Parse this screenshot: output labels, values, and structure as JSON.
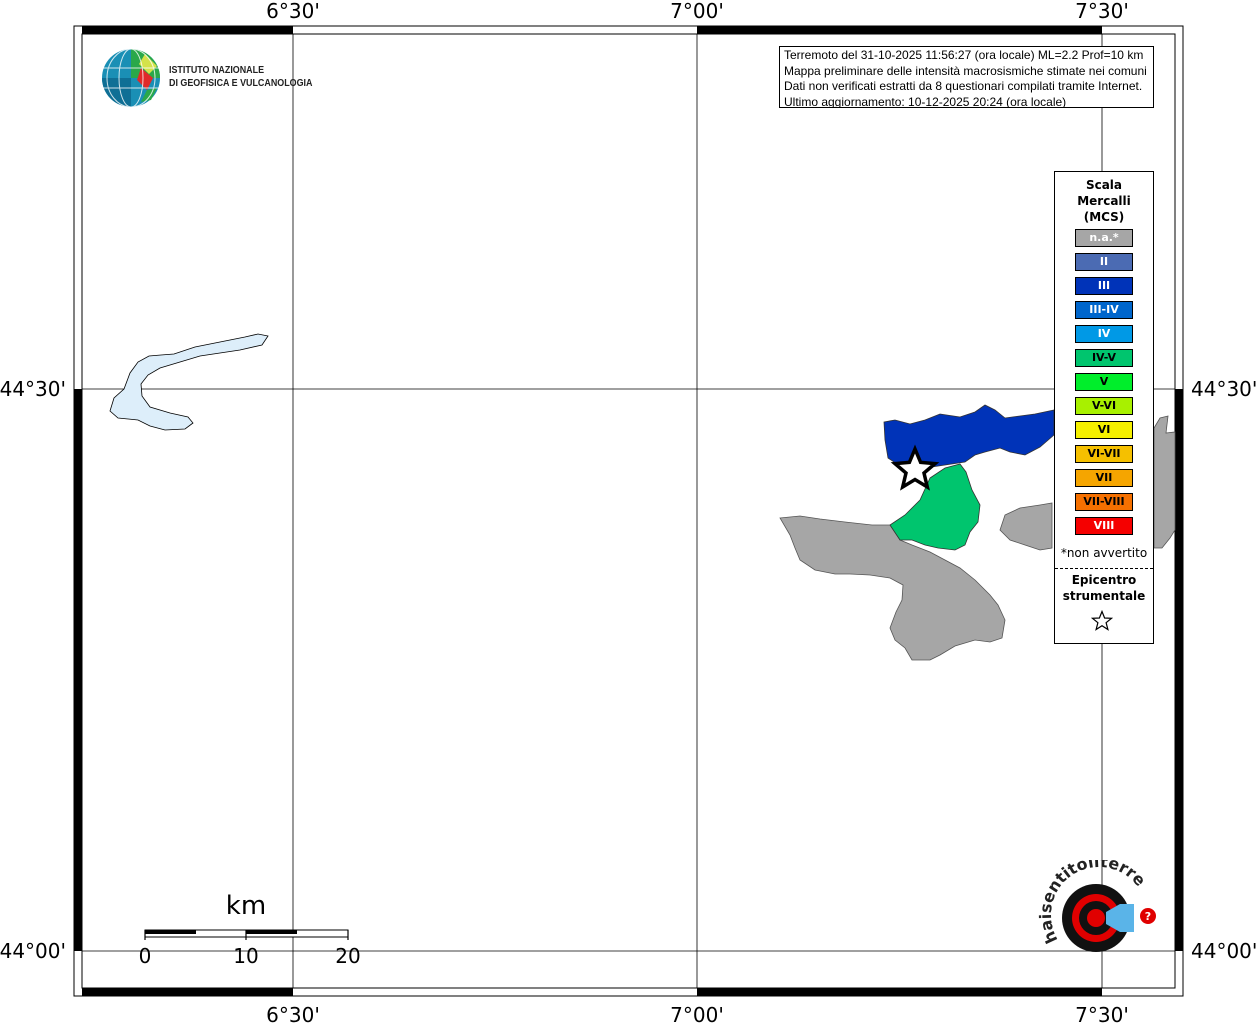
{
  "map": {
    "top_axis_labels": [
      "6°30'",
      "7°00'",
      "7°30'"
    ],
    "bottom_axis_labels": [
      "6°30'",
      "7°00'",
      "7°30'"
    ],
    "left_axis_labels": [
      "44°30'",
      "44°00'"
    ],
    "right_axis_labels": [
      "44°30'",
      "44°00'"
    ]
  },
  "info": {
    "line1": "Terremoto del 31-10-2025 11:56:27 (ora locale) ML=2.2 Prof=10 km",
    "line2": "Mappa preliminare delle intensità macrosismiche stimate nei comuni",
    "line3": "Dati non verificati estratti da 8 questionari compilati tramite Internet.",
    "line4": "Ultimo aggiornamento: 10-12-2025 20:24 (ora locale)"
  },
  "logo": {
    "line1": "ISTITUTO NAZIONALE",
    "line2": "DI GEOFISICA E VULCANOLOGIA"
  },
  "legend": {
    "title1": "Scala",
    "title2": "Mercalli",
    "title3": "(MCS)",
    "items": [
      {
        "label": "n.a.*",
        "color": "#a6a6a6"
      },
      {
        "label": "II",
        "color": "#4b6bb3"
      },
      {
        "label": "III",
        "color": "#0033b8"
      },
      {
        "label": "III-IV",
        "color": "#0066cc"
      },
      {
        "label": "IV",
        "color": "#0099e6"
      },
      {
        "label": "IV-V",
        "color": "#00c56e"
      },
      {
        "label": "V",
        "color": "#00ee2b"
      },
      {
        "label": "V-VI",
        "color": "#a8f000"
      },
      {
        "label": "VI",
        "color": "#f5f000"
      },
      {
        "label": "VI-VII",
        "color": "#f5c000"
      },
      {
        "label": "VII",
        "color": "#f5a500"
      },
      {
        "label": "VII-VIII",
        "color": "#f57000"
      },
      {
        "label": "VIII",
        "color": "#f50000"
      }
    ],
    "note": "*non avvertito",
    "epicenter_line1": "Epicentro",
    "epicenter_line2": "strumentale"
  },
  "scale": {
    "unit": "km",
    "ticks": [
      "0",
      "10",
      "20"
    ]
  },
  "colors": {
    "not_felt": "#a6a6a6",
    "intensity_iii": "#0033b8",
    "intensity_iv_v": "#00c56e",
    "lake": "#ddeefa"
  },
  "watermark": {
    "text": "haisentitoilterremoto.it"
  }
}
